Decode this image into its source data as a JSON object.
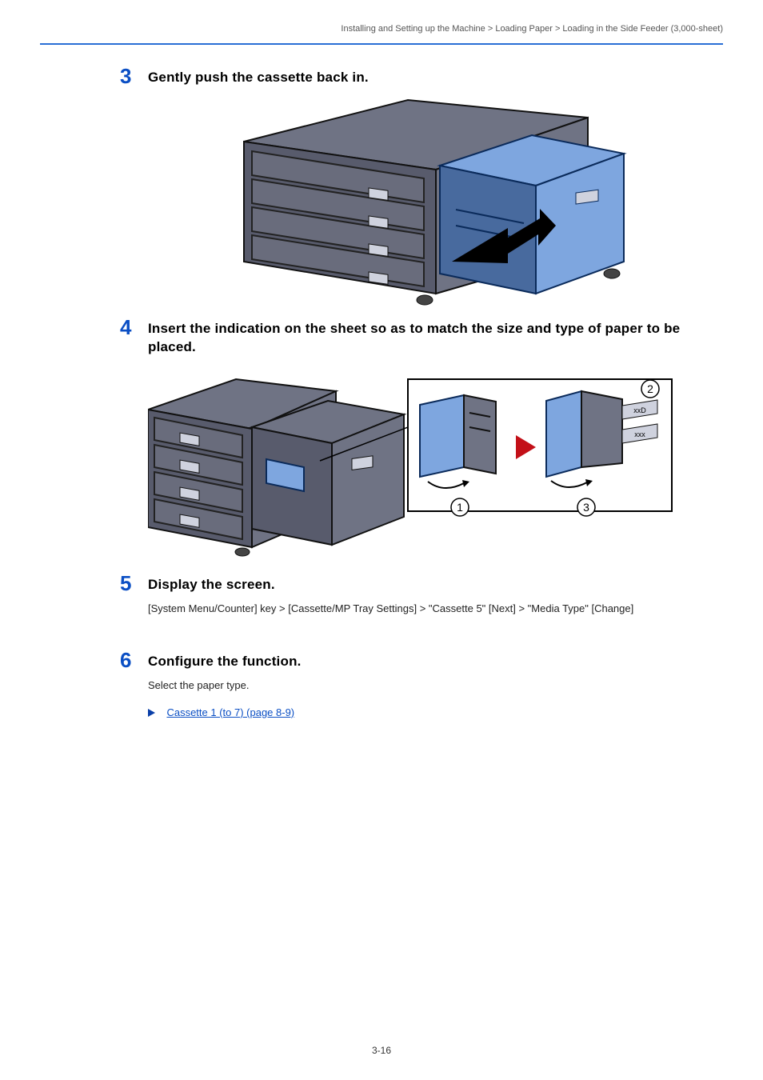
{
  "header": {
    "right": "Installing and Setting up the Machine > Loading Paper > Loading in the Side Feeder (3,000-sheet)"
  },
  "steps": {
    "s3": {
      "num": "3",
      "title": "Gently push the cassette back in."
    },
    "s4": {
      "num": "4",
      "title": "Insert the indication on the sheet so as to match the size and type of paper to be placed."
    },
    "s5": {
      "num": "5",
      "title": "Display the screen.",
      "path": "[System Menu/Counter] key > [Cassette/MP Tray Settings] > \"Cassette 5\" [Next] > \"Media Type\" [Change]"
    },
    "s6": {
      "num": "6",
      "title": "Configure the function.",
      "body": "Select the paper type.",
      "link": "Cassette 1 (to 7) (page 8-9)"
    }
  },
  "footer": {
    "page": "3-16"
  }
}
